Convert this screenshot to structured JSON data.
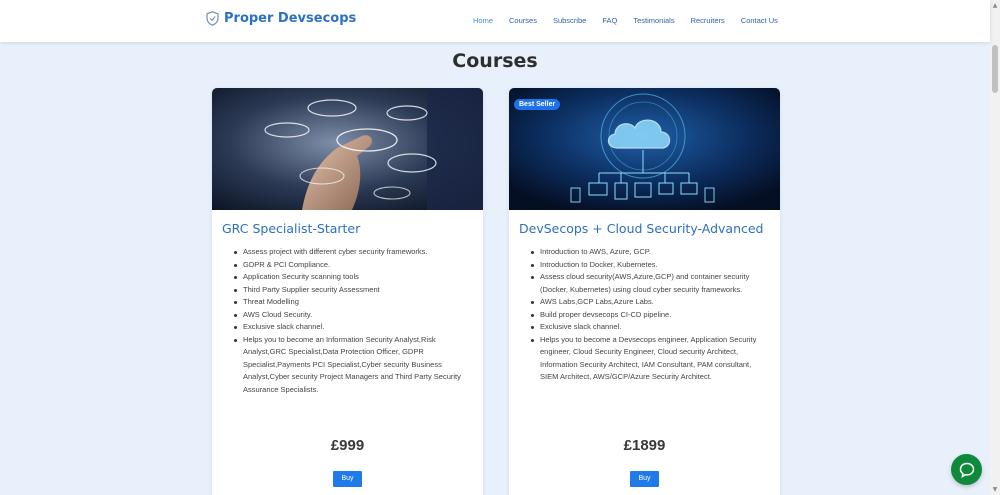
{
  "navbar": {
    "brand": "Proper Devsecops",
    "links": [
      "Home",
      "Courses",
      "Subscribe",
      "FAQ",
      "Testimonials",
      "Recruiters",
      "Contact Us"
    ]
  },
  "section": {
    "title": "Courses"
  },
  "courses": [
    {
      "title": "GRC Specialist-Starter",
      "badge": "",
      "features": [
        "Assess project with different cyber security frameworks.",
        "GDPR & PCI Compliance.",
        "Application Security scanning tools",
        "Third Party Supplier security Assessment",
        "Threat Modelling",
        "AWS Cloud Security.",
        "Exclusive slack channel.",
        "Helps you to become an Information Security Analyst,Risk Analyst,GRC Specialist,Data Protection Officer, GDPR Specialist,Payments PCI Specialist,Cyber security Business Analyst,Cyber security Project Managers and Third Party Security Assurance Specialists."
      ],
      "price": "£999",
      "buy_label": "Buy"
    },
    {
      "title": "DevSecops + Cloud Security-Advanced",
      "badge": "Best Seller",
      "features": [
        "Introduction to AWS, Azure, GCP.",
        "Introduction to Docker, Kubernetes.",
        "Assess cloud security(AWS,Azure,GCP) and container security (Docker, Kubernetes) using cloud cyber security frameworks.",
        "AWS Labs,GCP Labs,Azure Labs.",
        "Build proper devsecops CI-CD pipeline.",
        "Exclusive slack channel.",
        "Helps you to become a Devsecops engineer, Application Security engineer, Cloud Security Engineer, Cloud security Architect, Information Security Architect, IAM Consultant, PAM consultant, SIEM Architect, AWS/GCP/Azure Security Architect."
      ],
      "price": "£1899",
      "buy_label": "Buy"
    }
  ],
  "colors": {
    "brand": "#2a71c7",
    "background": "#e8f1fb",
    "button": "#1e7be8",
    "chat": "#0f8a3c"
  },
  "icons": {
    "brand": "shield-icon",
    "chat": "chat-bubble-icon"
  }
}
